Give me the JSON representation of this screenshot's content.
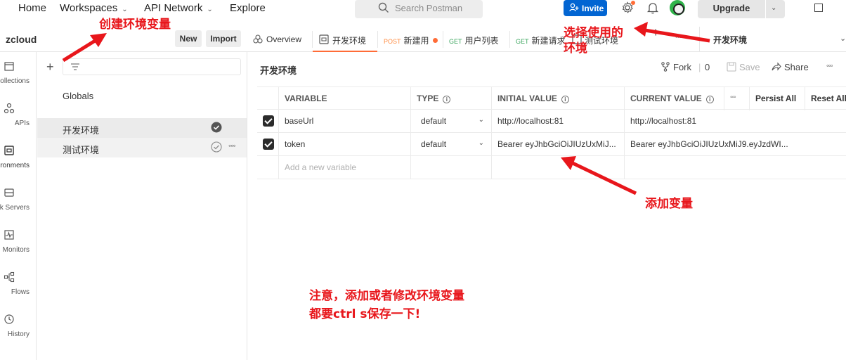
{
  "topnav": {
    "home": "Home",
    "workspaces": "Workspaces",
    "api_network": "API Network",
    "explore": "Explore",
    "search_placeholder": "Search Postman",
    "invite": "Invite",
    "upgrade": "Upgrade"
  },
  "workspace": {
    "name": "zcloud",
    "new_button": "New",
    "import_button": "Import"
  },
  "rail": [
    {
      "label": "Collections",
      "icon": "collections-icon"
    },
    {
      "label": "APIs",
      "icon": "apis-icon"
    },
    {
      "label": "Environments",
      "icon": "environments-icon"
    },
    {
      "label": "Mock Servers",
      "icon": "mock-servers-icon"
    },
    {
      "label": "Monitors",
      "icon": "monitors-icon"
    },
    {
      "label": "Flows",
      "icon": "flows-icon"
    },
    {
      "label": "History",
      "icon": "history-icon"
    }
  ],
  "env_list": {
    "globals": "Globals",
    "items": [
      {
        "name": "开发环境",
        "active": true
      },
      {
        "name": "测试环境",
        "active": false
      }
    ]
  },
  "tabs": [
    {
      "label": "Overview",
      "type": "overview"
    },
    {
      "label": "开发环境",
      "type": "environment",
      "active": true
    },
    {
      "method": "POST",
      "label": "新建用",
      "unsaved": true
    },
    {
      "method": "GET",
      "label": "用户列表"
    },
    {
      "method": "GET",
      "label": "新建请求"
    },
    {
      "label": "测试环境",
      "type": "environment"
    }
  ],
  "env_selector": {
    "selected": "开发环境"
  },
  "editor": {
    "title": "开发环境",
    "fork": "Fork",
    "fork_count": "0",
    "save": "Save",
    "share": "Share"
  },
  "table": {
    "headers": {
      "variable": "VARIABLE",
      "type": "TYPE",
      "initial_value": "INITIAL VALUE",
      "current_value": "CURRENT VALUE",
      "persist_all": "Persist All",
      "reset_all": "Reset All"
    },
    "rows": [
      {
        "enabled": true,
        "variable": "baseUrl",
        "type": "default",
        "initial": "http://localhost:81",
        "current": "http://localhost:81"
      },
      {
        "enabled": true,
        "variable": "token",
        "type": "default",
        "initial": "Bearer eyJhbGciOiJIUzUxMiJ...",
        "current": "Bearer eyJhbGciOiJIUzUxMiJ9.eyJzdWI..."
      }
    ],
    "add_placeholder": "Add a new variable"
  },
  "annotations": {
    "create_env": "创建环境变量",
    "select_env_line1": "选择使用的",
    "select_env_line2": "环境",
    "add_var": "添加变量",
    "note_line1": "注意，添加或者修改环境变量",
    "note_line2": "都要ctrl s保存一下!"
  },
  "colors": {
    "accent": "#ff6c37",
    "invite_blue": "#0265d2",
    "annotation_red": "#e8161b",
    "get_green": "#3aa55d",
    "post_orange": "#ff8c42"
  }
}
